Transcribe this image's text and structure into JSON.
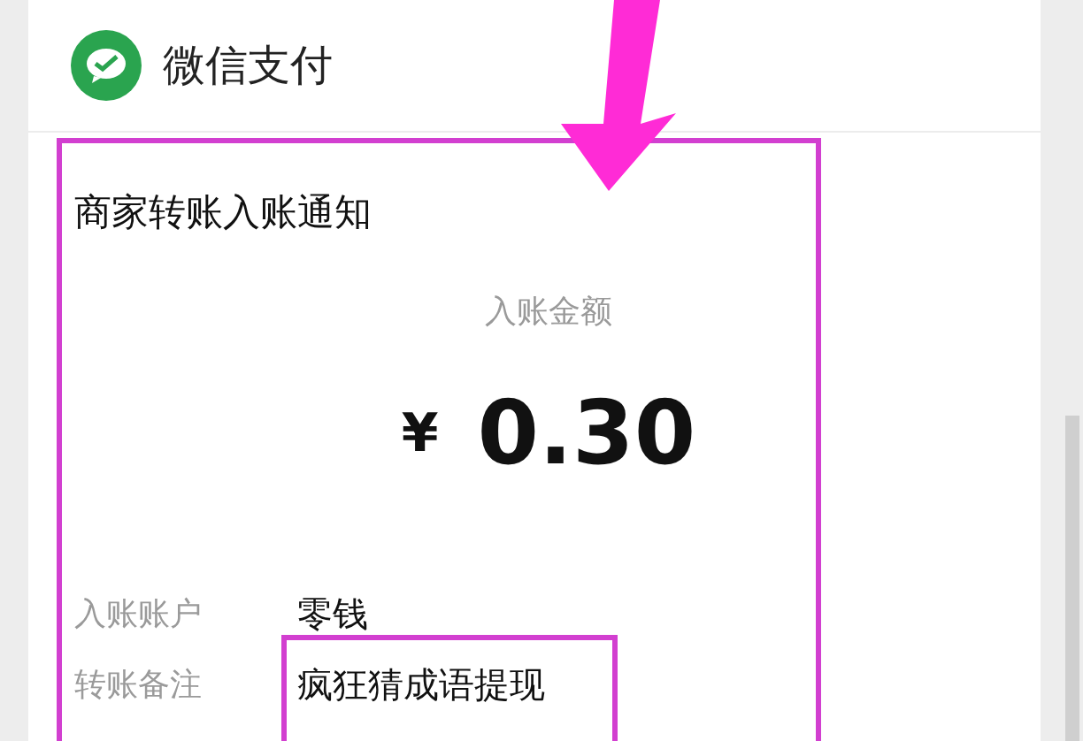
{
  "header": {
    "title": "微信支付"
  },
  "notification": {
    "title": "商家转账入账通知",
    "amount_label": "入账金额",
    "currency": "¥",
    "amount": "0.30",
    "details": [
      {
        "label": "入账账户",
        "value": "零钱"
      },
      {
        "label": "转账备注",
        "value": "疯狂猜成语提现"
      }
    ]
  }
}
